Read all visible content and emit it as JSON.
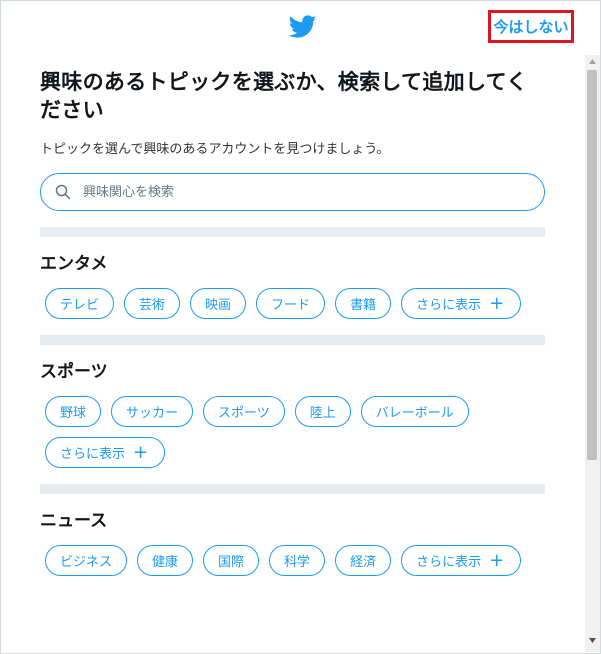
{
  "header": {
    "skip_label": "今はしない"
  },
  "main": {
    "title": "興味のあるトピックを選ぶか、検索して追加してください",
    "subtitle": "トピックを選んで興味のあるアカウントを見つけましょう。",
    "search": {
      "placeholder": "興味関心を検索"
    },
    "sections": [
      {
        "title": "エンタメ",
        "chips": [
          "テレビ",
          "芸術",
          "映画",
          "フード",
          "書籍"
        ],
        "more_label": "さらに表示"
      },
      {
        "title": "スポーツ",
        "chips": [
          "野球",
          "サッカー",
          "スポーツ",
          "陸上",
          "バレーボール"
        ],
        "more_label": "さらに表示"
      },
      {
        "title": "ニュース",
        "chips": [
          "ビジネス",
          "健康",
          "国際",
          "科学",
          "経済"
        ],
        "more_label": "さらに表示"
      }
    ]
  },
  "colors": {
    "accent": "#1d9bf0",
    "highlight_border": "#e0141e",
    "divider": "#e6ecf0"
  },
  "icons": {
    "logo": "twitter-bird-icon",
    "search": "search-icon",
    "plus": "plus-icon"
  }
}
